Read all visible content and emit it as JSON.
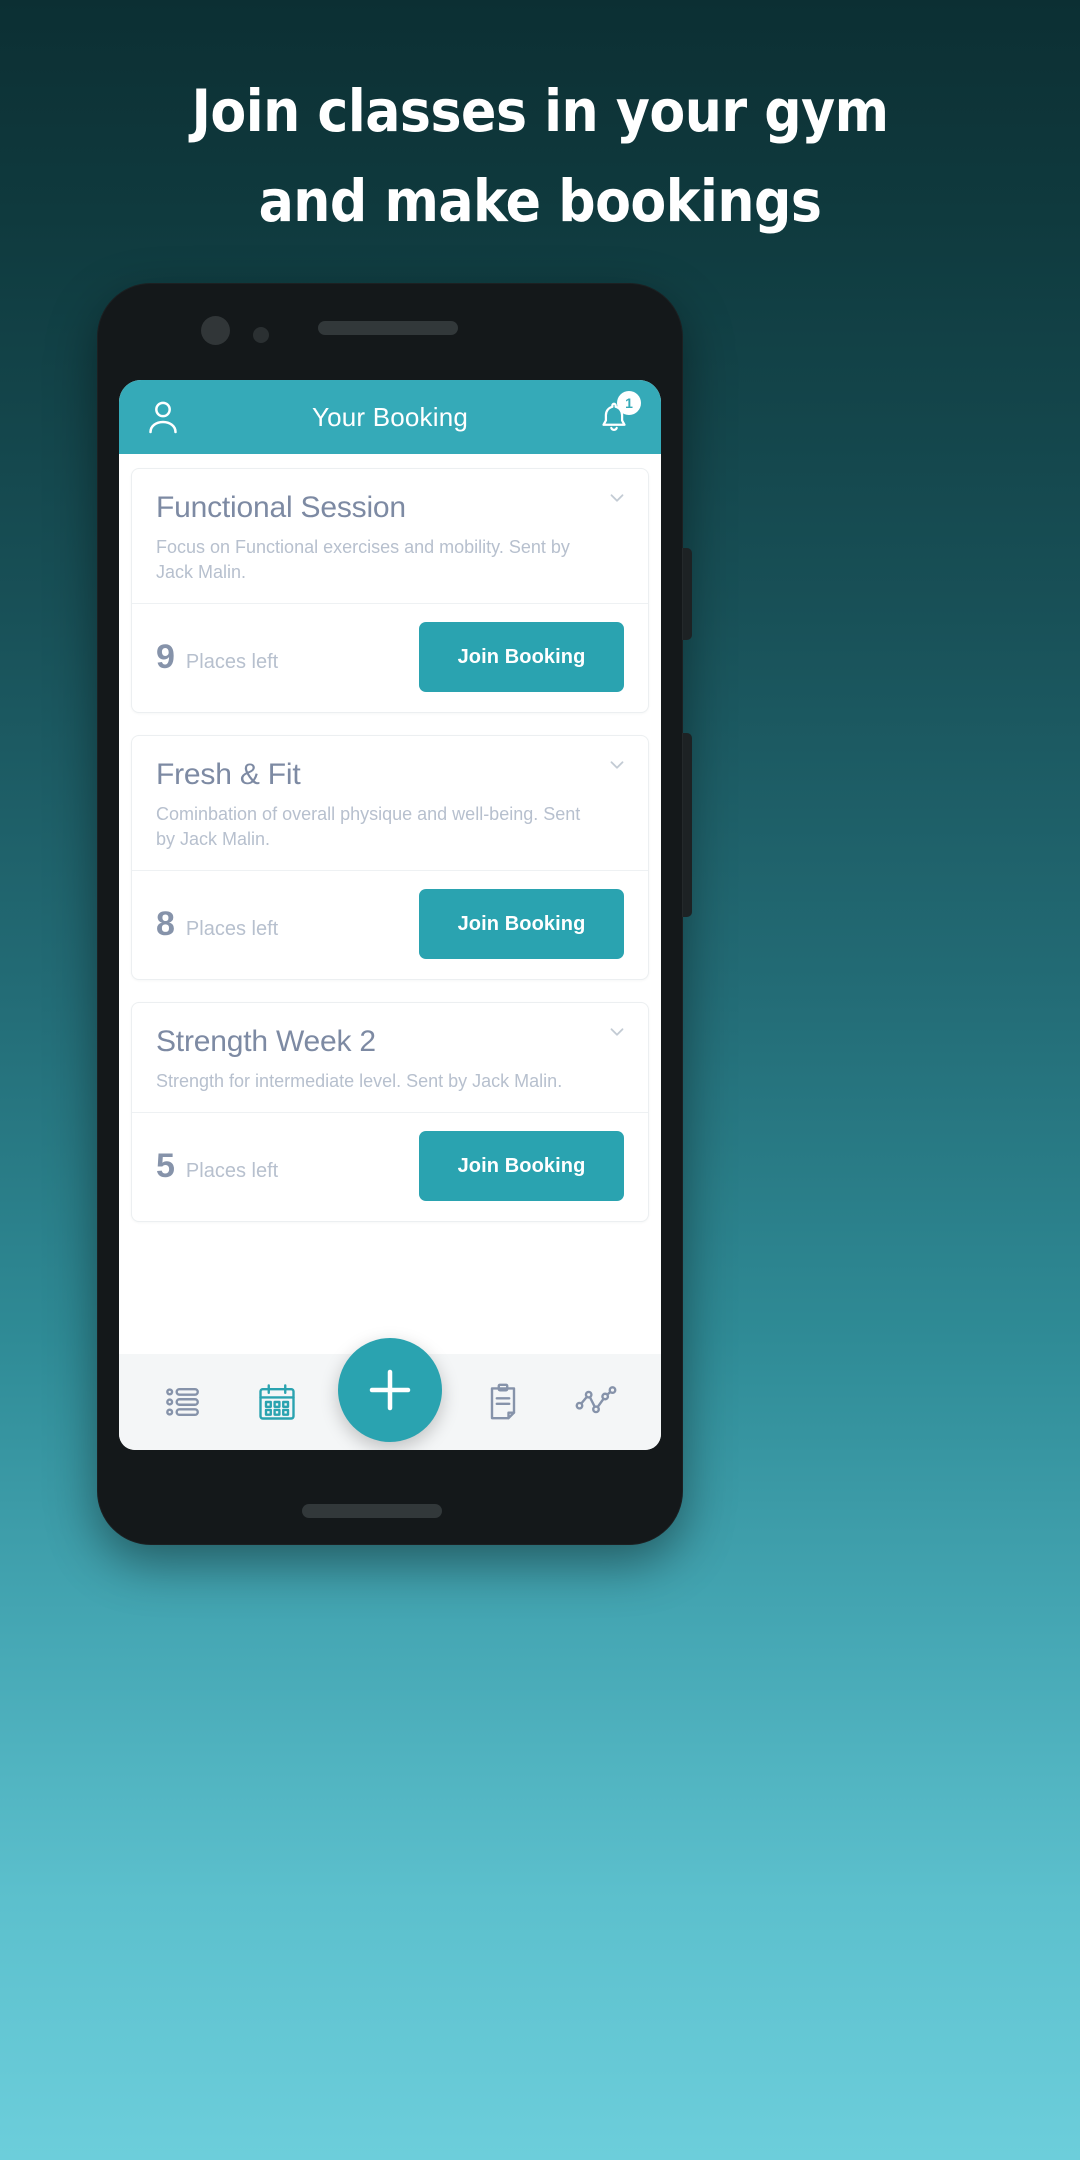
{
  "promo": {
    "headline_line1": "Join classes in your gym",
    "headline_line2": "and make bookings"
  },
  "colors": {
    "appbar": "#35aab8",
    "accent": "#2aa3b0",
    "bg_top": "#0c2f33",
    "bg_bottom": "#6ccedb",
    "card_title": "#7d8aa3",
    "card_desc": "#b7c0ce"
  },
  "appbar": {
    "title": "Your Booking",
    "avatar_icon": "person-icon",
    "bell_icon": "bell-icon",
    "notification_count": "1"
  },
  "bookings": [
    {
      "title": "Functional Session",
      "description": "Focus on Functional exercises and mobility. Sent by Jack Malin.",
      "places_count": "9",
      "places_label": "Places left",
      "button_label": "Join Booking",
      "expand_icon": "chevron-down-icon"
    },
    {
      "title": "Fresh & Fit",
      "description": "Cominbation of overall physique and well-being. Sent by Jack Malin.",
      "places_count": "8",
      "places_label": "Places left",
      "button_label": "Join Booking",
      "expand_icon": "chevron-down-icon"
    },
    {
      "title": "Strength Week 2",
      "description": "Strength for intermediate level. Sent by Jack Malin.",
      "places_count": "5",
      "places_label": "Places left",
      "button_label": "Join Booking",
      "expand_icon": "chevron-down-icon"
    }
  ],
  "bottom_nav": {
    "items": [
      {
        "icon": "list-icon",
        "active": false
      },
      {
        "icon": "calendar-icon",
        "active": true
      },
      {
        "icon": "clipboard-icon",
        "active": false
      },
      {
        "icon": "analytics-chart-icon",
        "active": false
      }
    ],
    "fab_icon": "plus-icon"
  }
}
